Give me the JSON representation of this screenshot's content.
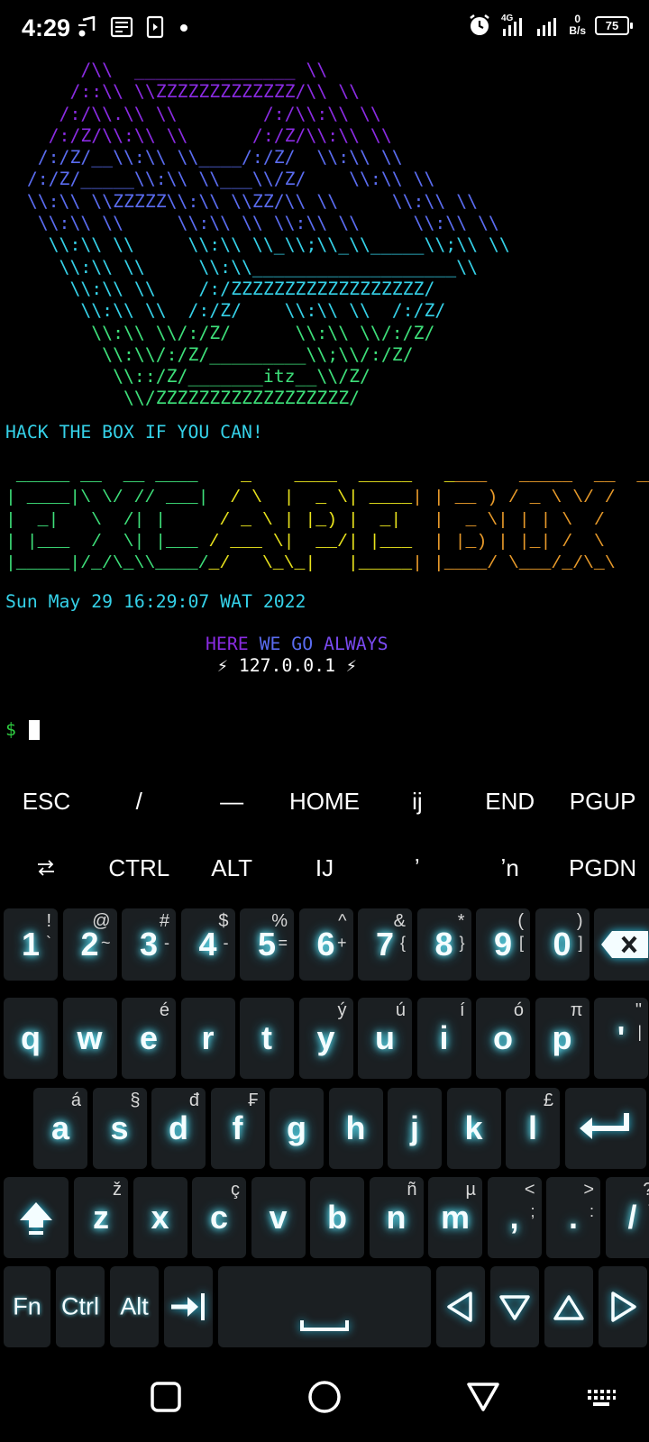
{
  "status_bar": {
    "time": "4:29",
    "left_icons": [
      "music-note-icon",
      "news-icon",
      "video-app-icon",
      "dot-icon"
    ],
    "right_icons": [
      "alarm-icon",
      "signal-4g-icon",
      "signal-icon"
    ],
    "net_speed_value": "0",
    "net_speed_unit": "B/s",
    "battery": "75"
  },
  "terminal": {
    "colors": {
      "purple": "#8a2be2",
      "blue": "#5a6cf0",
      "cyan": "#35d1e8",
      "green": "#3ee07a",
      "yellow": "#e8e21c",
      "orange": "#e89a2a",
      "prompt": "#2ecc40"
    },
    "ascii_art": [
      "       /\\\\  _______________ \\\\",
      "      /::\\\\ \\\\ZZZZZZZZZZZZZ/\\\\ \\\\",
      "     /:/\\\\.\\\\ \\\\        /:/\\\\:\\\\ \\\\",
      "    /:/Z/\\\\:\\\\ \\\\      /:/Z/\\\\:\\\\ \\\\",
      "   /:/Z/__\\\\:\\\\ \\\\____/:/Z/  \\\\:\\\\ \\\\",
      "  /:/Z/_____\\\\:\\\\ \\\\___\\\\/Z/    \\\\:\\\\ \\\\",
      "  \\\\:\\\\ \\\\ZZZZZ\\\\:\\\\ \\\\ZZ/\\\\ \\\\     \\\\:\\\\ \\\\",
      "   \\\\:\\\\ \\\\     \\\\:\\\\ \\\\ \\\\:\\\\ \\\\     \\\\:\\\\ \\\\",
      "    \\\\:\\\\ \\\\     \\\\:\\\\ \\\\_\\\\;\\\\_\\\\_____\\\\;\\\\ \\\\",
      "     \\\\:\\\\ \\\\     \\\\:\\\\___________________\\\\",
      "      \\\\:\\\\ \\\\    /:/ZZZZZZZZZZZZZZZZZZ/",
      "       \\\\:\\\\ \\\\  /:/Z/    \\\\:\\\\ \\\\  /:/Z/",
      "        \\\\:\\\\ \\\\/:/Z/      \\\\:\\\\ \\\\/:/Z/",
      "         \\\\:\\\\/:/Z/_________\\\\;\\\\/:/Z/",
      "          \\\\::/Z/_______itz__\\\\/Z/",
      "           \\\\/ZZZZZZZZZZZZZZZZZZ/"
    ],
    "tagline": "HACK THE BOX IF YOU CAN!",
    "banner": [
      " _____ __  __ ____    _    ____  _____   ____   _____  __  __",
      "| ____|\\ \\/ // ___|  / \\  |  _ \\| ____| | __ ) / _ \\ \\/ /",
      "|  _|   \\  /| |     / _ \\ | |_) |  _|   |  _ \\| | | \\  /",
      "| |___  /  \\| |___ / ___ \\|  __/| |___  | |_) | |_| /  \\",
      "|_____|/_/\\_\\\\____/_/   \\_\\_|   |_____| |____/ \\___/_/\\_\\"
    ],
    "date": "Sun May 29 16:29:07 WAT 2022",
    "motto_word1": "HERE",
    "motto_word2": "WE GO",
    "motto_word3": "ALWAYS",
    "ip_line": "⚡ 127.0.0.1 ⚡",
    "prompt": "$"
  },
  "extra_keys": {
    "row1": [
      "ESC",
      "/",
      "—",
      "HOME",
      "ij",
      "END",
      "PGUP"
    ],
    "row2_tab_icon": "tab-icon",
    "row2": [
      "CTRL",
      "ALT",
      "IJ",
      "ʼ",
      "ʼn",
      "PGDN"
    ]
  },
  "keyboard": {
    "number_row": [
      {
        "key": "1",
        "sec": "!",
        "sec2": "`"
      },
      {
        "key": "2",
        "sec": "@",
        "sec2": "~"
      },
      {
        "key": "3",
        "sec": "#",
        "sec2": "-"
      },
      {
        "key": "4",
        "sec": "$",
        "sec2": "-"
      },
      {
        "key": "5",
        "sec": "%",
        "sec2": "="
      },
      {
        "key": "6",
        "sec": "^",
        "sec2": "+"
      },
      {
        "key": "7",
        "sec": "&",
        "sec2": "{"
      },
      {
        "key": "8",
        "sec": "*",
        "sec2": "}"
      },
      {
        "key": "9",
        "sec": "(",
        "sec2": "["
      },
      {
        "key": "0",
        "sec": ")",
        "sec2": "]"
      }
    ],
    "row_q": [
      {
        "key": "q",
        "sec": ""
      },
      {
        "key": "w",
        "sec": ""
      },
      {
        "key": "e",
        "sec": "é"
      },
      {
        "key": "r",
        "sec": ""
      },
      {
        "key": "t",
        "sec": ""
      },
      {
        "key": "y",
        "sec": "ý"
      },
      {
        "key": "u",
        "sec": "ú"
      },
      {
        "key": "i",
        "sec": "í"
      },
      {
        "key": "o",
        "sec": "ó"
      },
      {
        "key": "p",
        "sec": "π"
      },
      {
        "key": "'",
        "sec": "\"",
        "sec2": "|"
      }
    ],
    "row_a": [
      {
        "key": "a",
        "sec": "á"
      },
      {
        "key": "s",
        "sec": "§"
      },
      {
        "key": "d",
        "sec": "đ"
      },
      {
        "key": "f",
        "sec": "₣"
      },
      {
        "key": "g",
        "sec": ""
      },
      {
        "key": "h",
        "sec": ""
      },
      {
        "key": "j",
        "sec": ""
      },
      {
        "key": "k",
        "sec": ""
      },
      {
        "key": "l",
        "sec": "£"
      }
    ],
    "row_z": [
      {
        "key": "z",
        "sec": "ž"
      },
      {
        "key": "x",
        "sec": ""
      },
      {
        "key": "c",
        "sec": "ç"
      },
      {
        "key": "v",
        "sec": ""
      },
      {
        "key": "b",
        "sec": ""
      },
      {
        "key": "n",
        "sec": "ñ"
      },
      {
        "key": "m",
        "sec": "µ"
      },
      {
        "key": ",",
        "sec": "<",
        "sec2": ";"
      },
      {
        "key": ".",
        "sec": ">",
        "sec2": ":"
      },
      {
        "key": "/",
        "sec": "?",
        "sec2": "\\"
      }
    ],
    "bottom_row": {
      "fn": "Fn",
      "ctrl": "Ctrl",
      "alt": "Alt",
      "icons": [
        "tab-arrow-icon",
        "space-bar-icon",
        "arrow-left-icon",
        "arrow-down-icon",
        "arrow-up-icon",
        "arrow-right-icon"
      ]
    },
    "glow_color": "#29c7ea",
    "key_color": "#1b1f22"
  },
  "nav_bar": {
    "icons": [
      "recents-square-icon",
      "home-circle-icon",
      "back-triangle-icon",
      "keyboard-switch-icon"
    ]
  }
}
